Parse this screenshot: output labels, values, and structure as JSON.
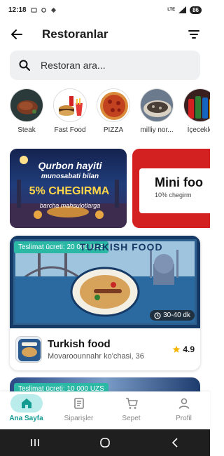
{
  "status": {
    "time": "12:18",
    "battery": "86",
    "network": "LTE"
  },
  "header": {
    "title": "Restoranlar"
  },
  "search": {
    "placeholder": "Restoran ara..."
  },
  "categories": [
    {
      "label": "Steak"
    },
    {
      "label": "Fast Food"
    },
    {
      "label": "PIZZA"
    },
    {
      "label": "milliy nor..."
    },
    {
      "label": "İçecekle"
    }
  ],
  "banners": {
    "first": {
      "line1": "Qurbon hayiti",
      "line2": "munosabati bilan",
      "line3": "5% CHEGIRMA",
      "line4": "barcha mahsulotlarga"
    },
    "second": {
      "title": "Mini foo",
      "subtitle": "10% chegirm"
    }
  },
  "restaurants": [
    {
      "delivery": "Teslimat ücreti: 20 000 UZS",
      "eta": "30-40 dk",
      "name": "Turkish food",
      "address": "Movaroounnahr ko'chasi, 36",
      "rating": "4.9",
      "photo_text": "TURKISH FOOD"
    },
    {
      "delivery": "Teslimat ücreti: 10 000 UZS"
    }
  ],
  "bottom_nav": [
    {
      "label": "Ana Sayfa",
      "icon": "home-icon",
      "active": true
    },
    {
      "label": "Siparişler",
      "icon": "orders-icon",
      "active": false
    },
    {
      "label": "Sepet",
      "icon": "cart-icon",
      "active": false
    },
    {
      "label": "Profil",
      "icon": "profile-icon",
      "active": false
    }
  ],
  "colors": {
    "accent": "#2bb8a5",
    "nav_active_bg": "#b9ecea",
    "promo_red": "#d32121",
    "rating_star": "#f4b400"
  }
}
